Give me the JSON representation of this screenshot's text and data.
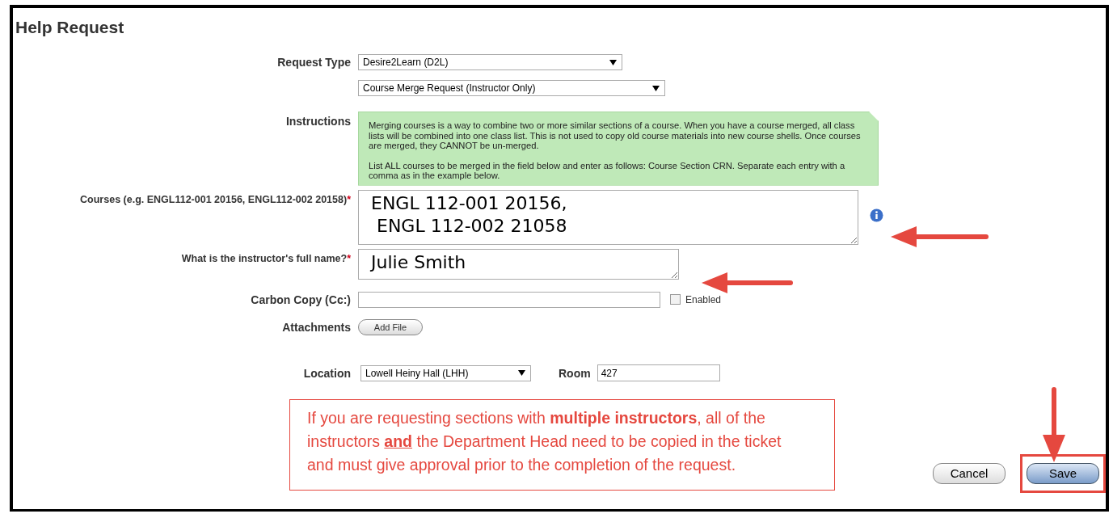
{
  "title": "Help Request",
  "form": {
    "request_type": {
      "label": "Request Type",
      "value": "Desire2Learn (D2L)"
    },
    "subtype": {
      "value": "Course Merge Request (Instructor Only)"
    },
    "instructions": {
      "label": "Instructions",
      "paragraphs": [
        "Merging courses is a way to combine two or more similar sections of a course. When you have a course merged, all class lists will be combined into one class list. This is not used to copy old course materials into new course shells. Once courses are merged, they CANNOT be un-merged.",
        "List ALL courses to be merged in the field below and enter as follows: Course Section CRN. Separate each entry with a comma as in the example below."
      ]
    },
    "courses": {
      "label": "Courses (e.g. ENGL112-001 20156, ENGL112-002 20158)",
      "required_mark": "*",
      "value": " ENGL 112-001 20156,\n  ENGL 112-002 21058"
    },
    "instructor": {
      "label": "What is the instructor's full name?",
      "required_mark": "*",
      "value": " Julie Smith"
    },
    "cc": {
      "label": "Carbon Copy (Cc:)",
      "checkbox_label": "Enabled",
      "checked": false
    },
    "attachments": {
      "label": "Attachments",
      "button": "Add File"
    },
    "location": {
      "label": "Location",
      "value": "Lowell Heiny Hall (LHH)"
    },
    "room": {
      "label": "Room",
      "value": "427"
    }
  },
  "callout": "If you are requesting sections with **multiple instructors**, all of the instructors **and** the Department Head need to be copied in the ticket and must give approval prior to the completion of the request.",
  "buttons": [
    {
      "label": "Cancel",
      "highlighted": false
    },
    {
      "label": "Save",
      "highlighted": true
    }
  ]
}
